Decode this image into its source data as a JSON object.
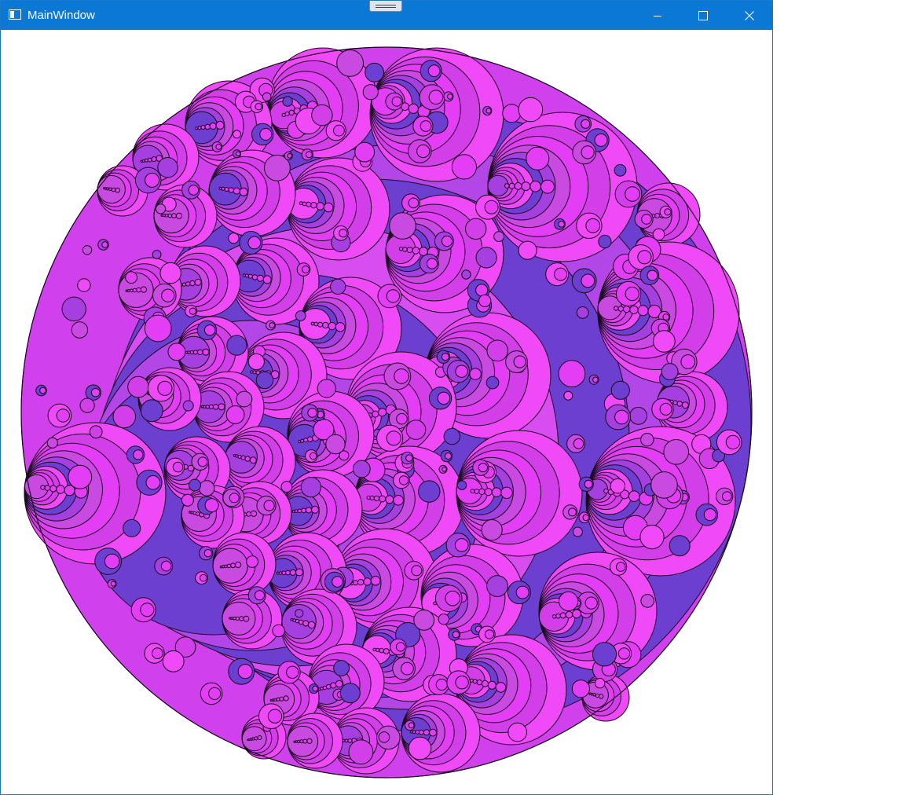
{
  "window": {
    "title": "MainWindow",
    "icons": {
      "app": "window-app-icon",
      "minimize": "minimize-icon",
      "maximize": "maximize-icon",
      "close": "close-icon"
    },
    "colors": {
      "titlebar": "#0a78d4",
      "title_text": "#ffffff"
    }
  },
  "artwork": {
    "description_icon": "circle-packing-fractal",
    "colors": {
      "palette": [
        "#e33ef5",
        "#c94ae0",
        "#a53fe0",
        "#6c3fd0",
        "#f04af8",
        "#d23fe8"
      ],
      "stroke": "#1a0a1f"
    }
  }
}
